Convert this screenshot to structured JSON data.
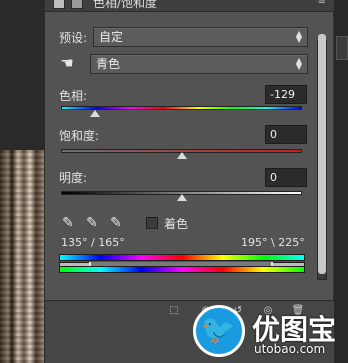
{
  "window": {
    "title": "色相/饱和度",
    "menu_glyph": "≡"
  },
  "preset": {
    "label": "预设:",
    "value": "自定"
  },
  "channel": {
    "value": "青色"
  },
  "hue": {
    "label": "色相:",
    "value": "-129",
    "level": -129
  },
  "saturation": {
    "label": "饱和度:",
    "value": "0",
    "level": 0
  },
  "lightness": {
    "label": "明度:",
    "value": "0",
    "level": 0
  },
  "colorize": {
    "label": "着色",
    "checked": false
  },
  "range": {
    "left": "135° / 165°",
    "right": "195° \\ 225°"
  },
  "watermark": {
    "name": "优图宝",
    "url": "utobao.com"
  },
  "colors": {
    "panel_bg": "#535353",
    "watermark_blue": "#1a9be0"
  }
}
